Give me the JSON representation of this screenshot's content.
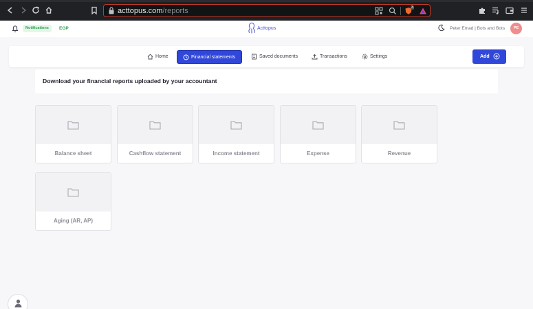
{
  "browser": {
    "url_host": "acttopus.com",
    "url_path": "/reports",
    "icons": [
      "back-icon",
      "forward-icon",
      "reload-icon",
      "home-icon",
      "bookmark-icon",
      "lock-icon",
      "qr-icon",
      "zoom-icon",
      "brave-shield-icon",
      "brave-rewards-icon",
      "extensions-icon",
      "playlist-icon",
      "wallet-icon"
    ],
    "shield_badge": "3"
  },
  "header": {
    "notifications_label": "Notifications",
    "currency": "EGP",
    "brand": "Acttopus",
    "user": "Peter Emad | Bots and Bots",
    "avatar_initials": "PE",
    "avatar_color": "#f08c8c"
  },
  "nav": {
    "tabs": [
      {
        "label": "Home",
        "icon": "home-icon"
      },
      {
        "label": "Financial statements",
        "icon": "clock-icon",
        "active": true
      },
      {
        "label": "Saved documents",
        "icon": "document-icon"
      },
      {
        "label": "Transactions",
        "icon": "upload-icon"
      },
      {
        "label": "Settings",
        "icon": "gear-icon"
      }
    ],
    "add_label": "Add"
  },
  "banner": {
    "text": "Download your financial reports uploaded by your accountant"
  },
  "reports": [
    {
      "label": "Balance sheet"
    },
    {
      "label": "Cashflow statement"
    },
    {
      "label": "Income statement"
    },
    {
      "label": "Expense"
    },
    {
      "label": "Revenue"
    },
    {
      "label": "Aging (AR, AP)"
    }
  ],
  "colors": {
    "accent": "#3047d9",
    "badge_green": "#2f9e4f",
    "chrome_bg": "#202124"
  }
}
